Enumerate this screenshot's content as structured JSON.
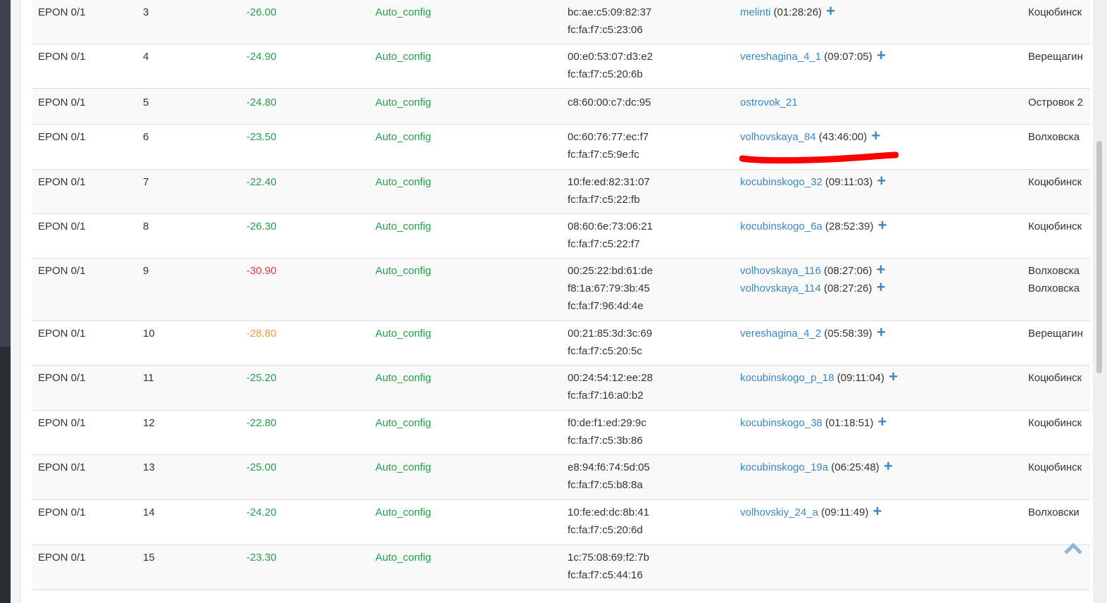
{
  "rows": [
    {
      "iface": "EPON 0/1",
      "num": "3",
      "signal": "-26.00",
      "signal_level": "green",
      "profile": "Auto_config",
      "macs": [
        "bc:ae:c5:09:82:37",
        "fc:fa:f7:c5:23:06"
      ],
      "users": [
        {
          "name": "melinti",
          "time": "(01:28:26)",
          "plus": true
        }
      ],
      "addresses": [
        "Коцюбинск"
      ]
    },
    {
      "iface": "EPON 0/1",
      "num": "4",
      "signal": "-24.90",
      "signal_level": "green",
      "profile": "Auto_config",
      "macs": [
        "00:e0:53:07:d3:e2",
        "fc:fa:f7:c5:20:6b"
      ],
      "users": [
        {
          "name": "vereshagina_4_1",
          "time": "(09:07:05)",
          "plus": true
        }
      ],
      "addresses": [
        "Верещагин"
      ]
    },
    {
      "iface": "EPON 0/1",
      "num": "5",
      "signal": "-24.80",
      "signal_level": "green",
      "profile": "Auto_config",
      "macs": [
        "c8:60:00:c7:dc:95"
      ],
      "users": [
        {
          "name": "ostrovok_21",
          "time": "",
          "plus": false
        }
      ],
      "addresses": [
        "Островок 2"
      ]
    },
    {
      "iface": "EPON 0/1",
      "num": "6",
      "signal": "-23.50",
      "signal_level": "green",
      "profile": "Auto_config",
      "macs": [
        "0c:60:76:77:ec:f7",
        "fc:fa:f7:c5:9e:fc"
      ],
      "users": [
        {
          "name": "volhovskaya_84",
          "time": "(43:46:00)",
          "plus": true
        }
      ],
      "addresses": [
        "Волховска"
      ]
    },
    {
      "iface": "EPON 0/1",
      "num": "7",
      "signal": "-22.40",
      "signal_level": "green",
      "profile": "Auto_config",
      "macs": [
        "10:fe:ed:82:31:07",
        "fc:fa:f7:c5:22:fb"
      ],
      "users": [
        {
          "name": "kocubinskogo_32",
          "time": "(09:11:03)",
          "plus": true
        }
      ],
      "addresses": [
        "Коцюбинск"
      ]
    },
    {
      "iface": "EPON 0/1",
      "num": "8",
      "signal": "-26.30",
      "signal_level": "green",
      "profile": "Auto_config",
      "macs": [
        "08:60:6e:73:06:21",
        "fc:fa:f7:c5:22:f7"
      ],
      "users": [
        {
          "name": "kocubinskogo_6a",
          "time": "(28:52:39)",
          "plus": true
        }
      ],
      "addresses": [
        "Коцюбинск"
      ]
    },
    {
      "iface": "EPON 0/1",
      "num": "9",
      "signal": "-30.90",
      "signal_level": "red",
      "profile": "Auto_config",
      "macs": [
        "00:25:22:bd:61:de",
        "f8:1a:67:79:3b:45",
        "fc:fa:f7:96:4d:4e"
      ],
      "users": [
        {
          "name": "volhovskaya_116",
          "time": "(08:27:06)",
          "plus": true
        },
        {
          "name": "volhovskaya_114",
          "time": "(08:27:26)",
          "plus": true
        }
      ],
      "addresses": [
        "Волховска",
        "Волховска"
      ]
    },
    {
      "iface": "EPON 0/1",
      "num": "10",
      "signal": "-28.80",
      "signal_level": "orange",
      "profile": "Auto_config",
      "macs": [
        "00:21:85:3d:3c:69",
        "fc:fa:f7:c5:20:5c"
      ],
      "users": [
        {
          "name": "vereshagina_4_2",
          "time": "(05:58:39)",
          "plus": true
        }
      ],
      "addresses": [
        "Верещагин"
      ]
    },
    {
      "iface": "EPON 0/1",
      "num": "11",
      "signal": "-25.20",
      "signal_level": "green",
      "profile": "Auto_config",
      "macs": [
        "00:24:54:12:ee:28",
        "fc:fa:f7:16:a0:b2"
      ],
      "users": [
        {
          "name": "kocubinskogo_p_18",
          "time": "(09:11:04)",
          "plus": true
        }
      ],
      "addresses": [
        "Коцюбинск"
      ]
    },
    {
      "iface": "EPON 0/1",
      "num": "12",
      "signal": "-22.80",
      "signal_level": "green",
      "profile": "Auto_config",
      "macs": [
        "f0:de:f1:ed:29:9c",
        "fc:fa:f7:c5:3b:86"
      ],
      "users": [
        {
          "name": "kocubinskogo_38",
          "time": "(01:18:51)",
          "plus": true
        }
      ],
      "addresses": [
        "Коцюбинск"
      ]
    },
    {
      "iface": "EPON 0/1",
      "num": "13",
      "signal": "-25.00",
      "signal_level": "green",
      "profile": "Auto_config",
      "macs": [
        "e8:94:f6:74:5d:05",
        "fc:fa:f7:c5:b8:8a"
      ],
      "users": [
        {
          "name": "kocubinskogo_19a",
          "time": "(06:25:48)",
          "plus": true
        }
      ],
      "addresses": [
        "Коцюбинск"
      ]
    },
    {
      "iface": "EPON 0/1",
      "num": "14",
      "signal": "-24.20",
      "signal_level": "green",
      "profile": "Auto_config",
      "macs": [
        "10:fe:ed:dc:8b:41",
        "fc:fa:f7:c5:20:6d"
      ],
      "users": [
        {
          "name": "volhovskiy_24_a",
          "time": "(09:11:49)",
          "plus": true
        }
      ],
      "addresses": [
        "Волховски"
      ]
    },
    {
      "iface": "EPON 0/1",
      "num": "15",
      "signal": "-23.30",
      "signal_level": "green",
      "profile": "Auto_config",
      "macs": [
        "1c:75:08:69:f2:7b",
        "fc:fa:f7:c5:44:16"
      ],
      "users": [],
      "addresses": []
    }
  ],
  "colors": {
    "green": "#22a04a",
    "red": "#dd3b3b",
    "orange": "#f0a030",
    "link": "#3a87c8",
    "annotation": "#ff0000"
  },
  "icons": {
    "add": "plus-icon",
    "scroll_top": "chevron-up-icon"
  }
}
